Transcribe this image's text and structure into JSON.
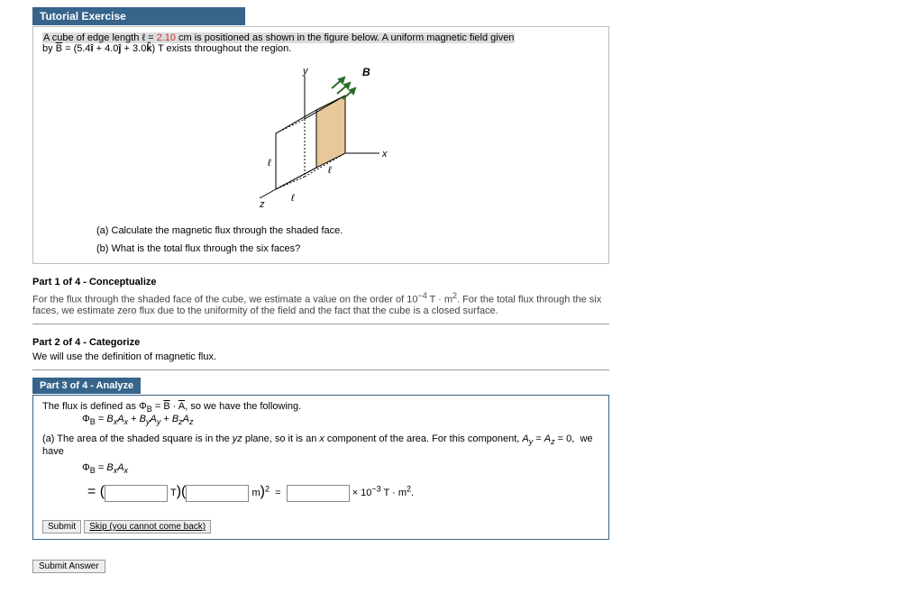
{
  "header": "Tutorial Exercise",
  "problem": {
    "line1_pre": "A cube of edge length ℓ = ",
    "edge_len": "2.10",
    "line1_post": " cm is positioned as shown in the figure below. A uniform magnetic field given",
    "line2_pre": "by ",
    "B": "B",
    "eq": " = (5.4",
    "i": "î",
    "plus1": " + 4.0",
    "j": "ĵ",
    "plus2": " + 3.0",
    "k": "k̂",
    "line2_post": ") T exists throughout the region."
  },
  "fig": {
    "B": "B",
    "x": "x",
    "y": "y",
    "z": "z",
    "ell": "ℓ"
  },
  "qa": "(a) Calculate the magnetic flux through the shaded face.",
  "qb": "(b) What is the total flux through the six faces?",
  "p1": {
    "title": "Part 1 of 4 - Conceptualize",
    "text_a": "For the flux through the shaded face of the cube, we estimate a value on the order of 10",
    "exp": "−4",
    "text_b": " T · m",
    "sq": "2",
    "text_c": ". For the total flux through the six faces, we estimate zero flux due to the uniformity of the field and the fact that the cube is a closed surface."
  },
  "p2": {
    "title": "Part 2 of 4 - Categorize",
    "text": "We will use the definition of magnetic flux."
  },
  "p3": {
    "title": "Part 3 of 4 - Analyze",
    "flux_def_a": "The flux is defined as  Φ",
    "flux_def_b": " = ",
    "flux_def_c": " · ",
    "flux_def_d": ",  so we have the following.",
    "eqline": "ΦB = BxAx + ByAy + BzAz",
    "area_text": "(a) The area of the shaded square is in the yz plane, so it is an x component of the area. For this component, Ay = Az = 0,  we have",
    "eq2": "ΦB = BxAx",
    "T": "T",
    "m": "m",
    "eq": "=",
    "res_tail": " × 10",
    "res_exp": "−3",
    "res_unit": " T · m",
    "res_sq": "2",
    "res_dot": ".",
    "submit": "Submit",
    "skip": "Skip (you cannot come back)"
  },
  "submit_ans": "Submit Answer"
}
